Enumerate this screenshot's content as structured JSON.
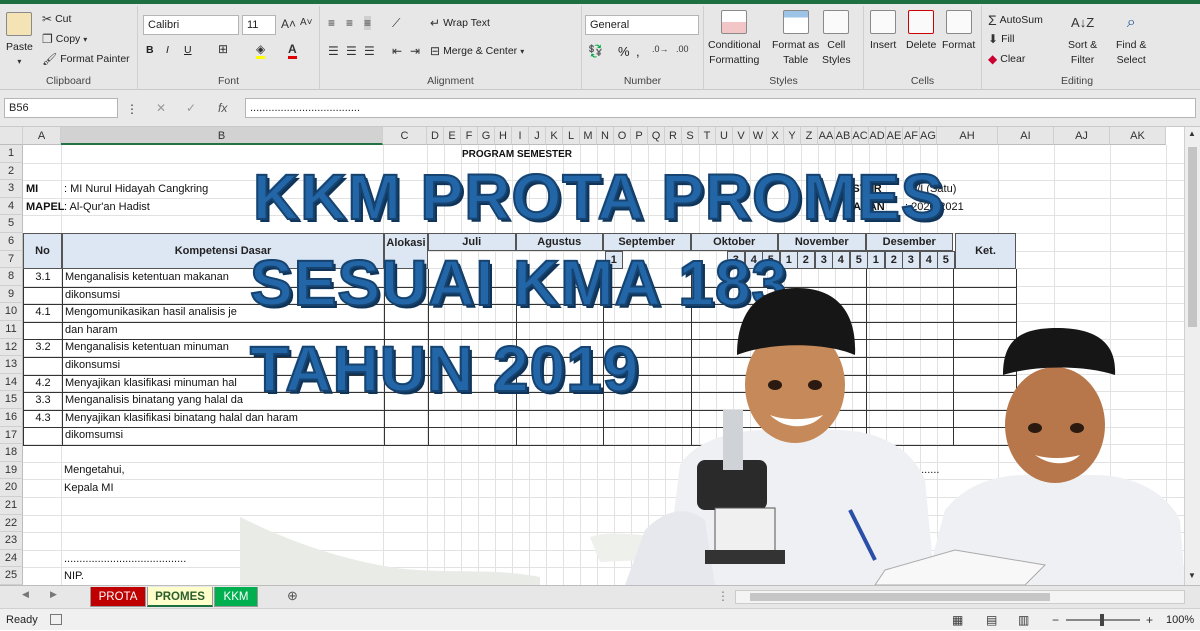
{
  "ribbon": {
    "clipboard": {
      "label": "Clipboard",
      "paste": "Paste",
      "cut": "Cut",
      "copy": "Copy",
      "format_painter": "Format Painter"
    },
    "font": {
      "label": "Font",
      "name": "Calibri",
      "size": "11",
      "bold": "B",
      "italic": "I",
      "underline": "U"
    },
    "alignment": {
      "label": "Alignment",
      "wrap": "Wrap Text",
      "merge": "Merge & Center"
    },
    "number": {
      "label": "Number",
      "format": "General",
      "percent": "%",
      "comma": ","
    },
    "styles": {
      "label": "Styles",
      "conditional": "Conditional",
      "conditional2": "Formatting",
      "format_table": "Format as",
      "format_table2": "Table",
      "cell_styles": "Cell",
      "cell_styles2": "Styles"
    },
    "cells": {
      "label": "Cells",
      "insert": "Insert",
      "delete": "Delete",
      "format": "Format"
    },
    "editing": {
      "label": "Editing",
      "autosum": "AutoSum",
      "fill": "Fill",
      "clear": "Clear",
      "sort": "Sort &",
      "sort2": "Filter",
      "find": "Find &",
      "find2": "Select"
    }
  },
  "formula_bar": {
    "name_box": "B56",
    "fx": "fx",
    "content": "...................................."
  },
  "columns": [
    "A",
    "B",
    "C",
    "D",
    "E",
    "F",
    "G",
    "H",
    "I",
    "J",
    "K",
    "L",
    "M",
    "N",
    "O",
    "P",
    "Q",
    "R",
    "S",
    "T",
    "U",
    "V",
    "W",
    "X",
    "Y",
    "Z",
    "AA",
    "AB",
    "AC",
    "AD",
    "AE",
    "AF",
    "AG",
    "AH",
    "AI",
    "AJ",
    "AK"
  ],
  "rows": [
    "1",
    "2",
    "3",
    "4",
    "5",
    "6",
    "7",
    "8",
    "9",
    "10",
    "11",
    "12",
    "13",
    "14",
    "15",
    "16",
    "17",
    "18",
    "19",
    "20",
    "21",
    "22",
    "23",
    "24",
    "25"
  ],
  "sheet": {
    "title": "PROGRAM SEMESTER",
    "mi_label": "MI",
    "mi_value": ": MI Nurul Hidayah Cangkring",
    "mapel_label": "MAPEL",
    "mapel_value": ": Al-Qur'an Hadist",
    "semester_label": "ESTER",
    "semester_value": ": 6/I (Satu)",
    "tahun_label": "UARAN",
    "tahun_value": ": 2020-2021",
    "h_no": "No",
    "h_kd": "Kompetensi Dasar",
    "h_alokasi": "Alokasi",
    "h_ket": "Ket.",
    "months": [
      "Juli",
      "Agustus",
      "September",
      "Oktober",
      "November",
      "Desember"
    ],
    "week_nums": [
      "1",
      "3",
      "4",
      "5",
      "1",
      "2",
      "3",
      "4",
      "5",
      "1",
      "2",
      "3",
      "4",
      "5"
    ],
    "items": [
      {
        "no": "3.1",
        "text": "Menganalisis ketentuan makanan"
      },
      {
        "no": "",
        "text": "dikonsumsi"
      },
      {
        "no": "4.1",
        "text": "Mengomunikasikan hasil analisis je"
      },
      {
        "no": "",
        "text": "dan haram"
      },
      {
        "no": "3.2",
        "text": "Menganalisis ketentuan minuman"
      },
      {
        "no": "",
        "text": "dikonsumsi"
      },
      {
        "no": "4.2",
        "text": "Menyajikan klasifikasi minuman hal"
      },
      {
        "no": "3.3",
        "text": "Menganalisis binatang yang halal da"
      },
      {
        "no": "4.3",
        "text": "Menyajikan klasifikasi binatang halal dan haram"
      },
      {
        "no": "",
        "text": "dikomsumsi"
      }
    ],
    "mengetahui": "Mengetahui,",
    "kepala": "Kepala MI",
    "dots": "........................................",
    "nip": "NIP.",
    "dots_right": "........"
  },
  "overlay": {
    "line1": "KKM PROTA PROMES",
    "line2": "SESUAI KMA 183",
    "line3": "TAHUN 2019"
  },
  "tabs": [
    "PROTA",
    "PROMES",
    "KKM"
  ],
  "tab_colors": {
    "prota": "#c00000",
    "promes": "#ffffcc",
    "kkm": "#00b050"
  },
  "status": {
    "ready": "Ready",
    "zoom": "100%"
  }
}
